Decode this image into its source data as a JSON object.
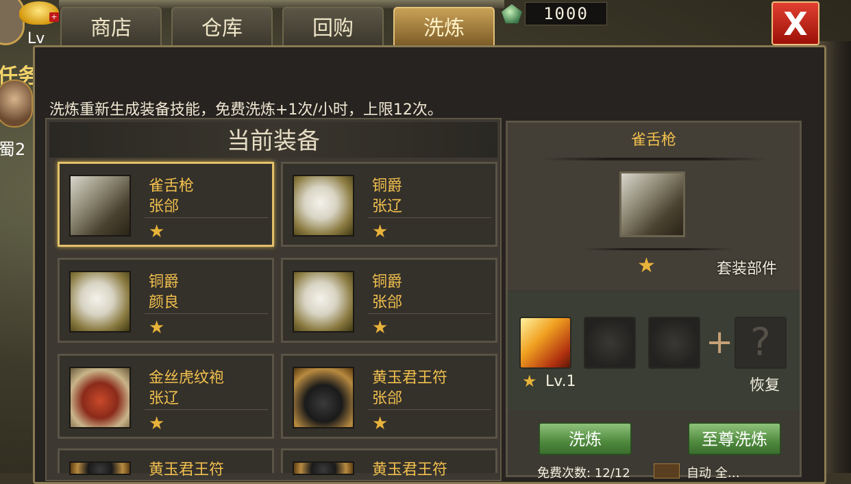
{
  "hud": {
    "level_label": "Lv",
    "left_banner": "任务",
    "left_text": "蜀2"
  },
  "tabs": [
    {
      "label": "商店"
    },
    {
      "label": "仓库"
    },
    {
      "label": "回购"
    },
    {
      "label": "洗炼",
      "active": true
    }
  ],
  "resource": {
    "value": "1000",
    "icon": "gem-icon"
  },
  "close_label": "X",
  "description": "洗炼重新生成装备技能，免费洗炼+1次/小时，上限12次。",
  "equipment_panel": {
    "title": "当前装备",
    "items": [
      {
        "name": "雀舌枪",
        "owner": "张郃",
        "stars": "★",
        "icon": "spear",
        "selected": true
      },
      {
        "name": "铜爵",
        "owner": "张辽",
        "stars": "★",
        "icon": "horse"
      },
      {
        "name": "铜爵",
        "owner": "颜良",
        "stars": "★",
        "icon": "horse"
      },
      {
        "name": "铜爵",
        "owner": "张郃",
        "stars": "★",
        "icon": "horse"
      },
      {
        "name": "金丝虎纹袍",
        "owner": "张辽",
        "stars": "★",
        "icon": "robe"
      },
      {
        "name": "黄玉君王符",
        "owner": "张郃",
        "stars": "★",
        "icon": "tiger"
      },
      {
        "name": "黄玉君王符",
        "owner": "",
        "stars": "",
        "icon": "tiger"
      },
      {
        "name": "黄玉君王符",
        "owner": "",
        "stars": "",
        "icon": "tiger"
      }
    ]
  },
  "detail": {
    "name": "雀舌枪",
    "stars": "★",
    "set_label": "套装部件",
    "skill_level": "Lv.1",
    "skill_star": "★",
    "plus": "+",
    "mystery": "?",
    "restore_label": "恢复",
    "refine_label": "洗炼",
    "supreme_refine_label": "至尊洗炼",
    "free_count_label": "免费次数: 12/12",
    "checkbox_label": "自动 全…"
  },
  "colors": {
    "accent_gold": "#f2c14e",
    "star": "#e8b33a",
    "button_green": "#4f8a3e",
    "close_red": "#c01818"
  }
}
